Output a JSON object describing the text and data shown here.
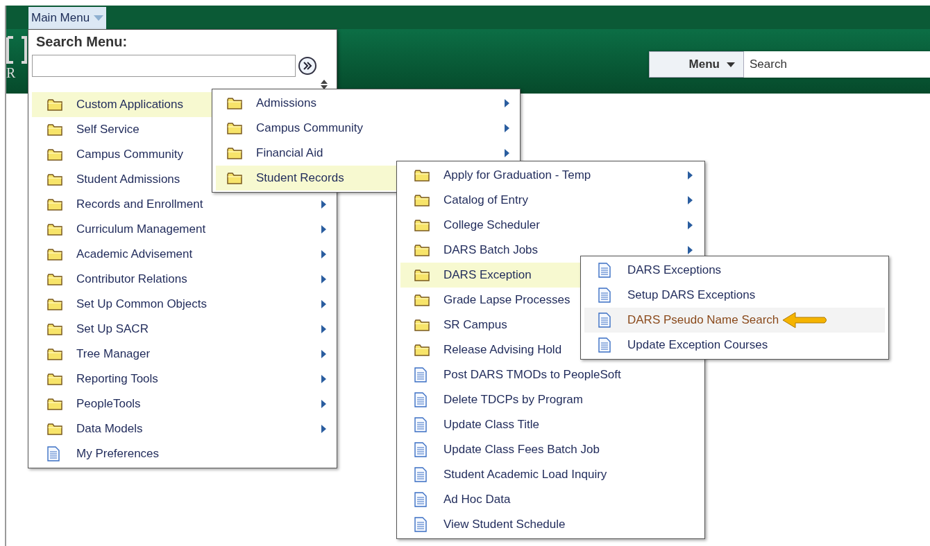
{
  "top_bar": {
    "main_menu_button": "Main Menu"
  },
  "header": {
    "logo_text": "R",
    "menu_button": "Menu",
    "search": {
      "placeholder": "Search"
    }
  },
  "menus": [
    {
      "kind": "root",
      "title": "Search Menu:",
      "items": [
        {
          "label": "Custom Applications",
          "kind": "folder",
          "arrow": false,
          "selected": true
        },
        {
          "label": "Self Service",
          "kind": "folder",
          "arrow": false,
          "selected": false
        },
        {
          "label": "Campus Community",
          "kind": "folder",
          "arrow": false,
          "selected": false
        },
        {
          "label": "Student Admissions",
          "kind": "folder",
          "arrow": false,
          "selected": false
        },
        {
          "label": "Records and Enrollment",
          "kind": "folder",
          "arrow": true,
          "selected": false
        },
        {
          "label": "Curriculum Management",
          "kind": "folder",
          "arrow": true,
          "selected": false
        },
        {
          "label": "Academic Advisement",
          "kind": "folder",
          "arrow": true,
          "selected": false
        },
        {
          "label": "Contributor Relations",
          "kind": "folder",
          "arrow": true,
          "selected": false
        },
        {
          "label": "Set Up Common Objects",
          "kind": "folder",
          "arrow": true,
          "selected": false
        },
        {
          "label": "Set Up SACR",
          "kind": "folder",
          "arrow": true,
          "selected": false
        },
        {
          "label": "Tree Manager",
          "kind": "folder",
          "arrow": true,
          "selected": false
        },
        {
          "label": "Reporting Tools",
          "kind": "folder",
          "arrow": true,
          "selected": false
        },
        {
          "label": "PeopleTools",
          "kind": "folder",
          "arrow": true,
          "selected": false
        },
        {
          "label": "Data Models",
          "kind": "folder",
          "arrow": true,
          "selected": false
        },
        {
          "label": "My Preferences",
          "kind": "page",
          "arrow": false,
          "selected": false
        }
      ]
    },
    {
      "kind": "submenu",
      "items": [
        {
          "label": "Admissions",
          "kind": "folder",
          "arrow": true,
          "selected": false
        },
        {
          "label": "Campus Community",
          "kind": "folder",
          "arrow": true,
          "selected": false
        },
        {
          "label": "Financial Aid",
          "kind": "folder",
          "arrow": true,
          "selected": false
        },
        {
          "label": "Student Records",
          "kind": "folder",
          "arrow": false,
          "selected": true
        }
      ]
    },
    {
      "kind": "submenu",
      "items": [
        {
          "label": "Apply for Graduation - Temp",
          "kind": "folder",
          "arrow": true,
          "selected": false
        },
        {
          "label": "Catalog of Entry",
          "kind": "folder",
          "arrow": true,
          "selected": false
        },
        {
          "label": "College Scheduler",
          "kind": "folder",
          "arrow": true,
          "selected": false
        },
        {
          "label": "DARS Batch Jobs",
          "kind": "folder",
          "arrow": true,
          "selected": false
        },
        {
          "label": "DARS Exception",
          "kind": "folder",
          "arrow": false,
          "selected": true
        },
        {
          "label": "Grade Lapse Processes",
          "kind": "folder",
          "arrow": false,
          "selected": false
        },
        {
          "label": "SR Campus",
          "kind": "folder",
          "arrow": false,
          "selected": false
        },
        {
          "label": "Release Advising Hold",
          "kind": "folder",
          "arrow": false,
          "selected": false
        },
        {
          "label": "Post DARS TMODs to PeopleSoft",
          "kind": "page",
          "arrow": false,
          "selected": false
        },
        {
          "label": "Delete TDCPs by Program",
          "kind": "page",
          "arrow": false,
          "selected": false
        },
        {
          "label": "Update Class Title",
          "kind": "page",
          "arrow": false,
          "selected": false
        },
        {
          "label": "Update Class Fees Batch Job",
          "kind": "page",
          "arrow": false,
          "selected": false
        },
        {
          "label": "Student Academic Load Inquiry",
          "kind": "page",
          "arrow": false,
          "selected": false
        },
        {
          "label": "Ad Hoc Data",
          "kind": "page",
          "arrow": false,
          "selected": false
        },
        {
          "label": "View Student Schedule",
          "kind": "page",
          "arrow": false,
          "selected": false
        }
      ]
    },
    {
      "kind": "submenu",
      "items": [
        {
          "label": "DARS Exceptions",
          "kind": "page",
          "arrow": false,
          "selected": false
        },
        {
          "label": "Setup DARS Exceptions",
          "kind": "page",
          "arrow": false,
          "selected": false
        },
        {
          "label": "DARS Pseudo Name Search",
          "kind": "page",
          "arrow": false,
          "selected": true,
          "pointer": true
        },
        {
          "label": "Update Exception Courses",
          "kind": "page",
          "arrow": false,
          "selected": false
        }
      ]
    }
  ]
}
